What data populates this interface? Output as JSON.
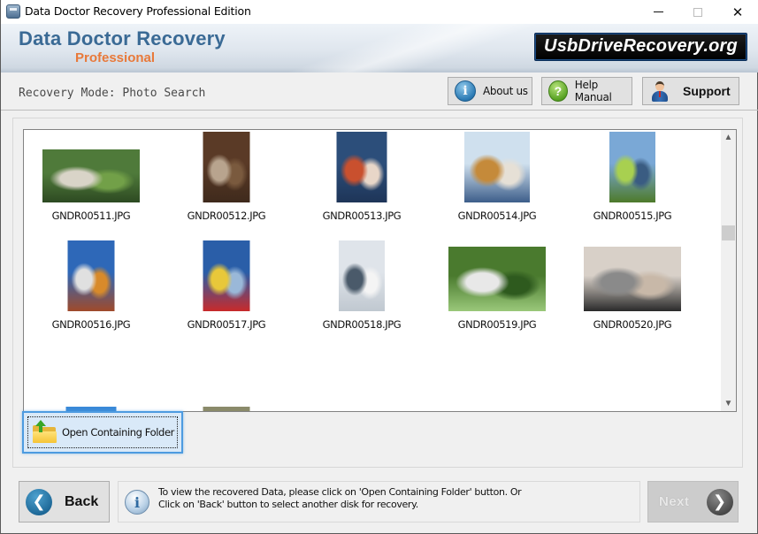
{
  "window": {
    "title": "Data Doctor Recovery Professional Edition",
    "controls": {
      "minimize": "minimize",
      "maximize": "maximize",
      "close": "✕"
    }
  },
  "header": {
    "brand_main": "Data Doctor Recovery",
    "brand_sub": "Professional",
    "site_badge": "UsbDriveRecovery.org"
  },
  "mode_bar": {
    "mode_label": "Recovery Mode: Photo Search",
    "buttons": {
      "about": {
        "label": "About us",
        "icon": "info-icon"
      },
      "help": {
        "label": "Help Manual",
        "icon": "question-icon"
      },
      "support": {
        "label": "Support",
        "icon": "person-icon"
      }
    }
  },
  "gallery": {
    "items": [
      {
        "name": "GNDR00511.JPG",
        "colors": [
          "#4f7a3a",
          "#2d4a22",
          "#d9d4c8",
          "#72a048"
        ]
      },
      {
        "name": "GNDR00512.JPG",
        "colors": [
          "#5a3a26",
          "#3f2a1c",
          "#b8a48e",
          "#7a5a3e"
        ]
      },
      {
        "name": "GNDR00513.JPG",
        "colors": [
          "#2c4e7a",
          "#1e3558",
          "#c9502e",
          "#e8d6c8"
        ]
      },
      {
        "name": "GNDR00514.JPG",
        "colors": [
          "#cfe0ee",
          "#3d5e8a",
          "#c58a3a",
          "#e6e0d6"
        ]
      },
      {
        "name": "GNDR00515.JPG",
        "colors": [
          "#7aa8d6",
          "#4e7a2a",
          "#a8d050",
          "#3a5c82"
        ]
      },
      {
        "name": "GNDR00516.JPG",
        "colors": [
          "#2e68b8",
          "#a04a2a",
          "#e0e0e0",
          "#d88a2a"
        ]
      },
      {
        "name": "GNDR00517.JPG",
        "colors": [
          "#2a5ea8",
          "#c82a2a",
          "#e8c83a",
          "#9ab8d8"
        ]
      },
      {
        "name": "GNDR00518.JPG",
        "colors": [
          "#dfe4ea",
          "#c0c8d0",
          "#4a5a6a",
          "#f4f4f4"
        ]
      },
      {
        "name": "GNDR00519.JPG",
        "colors": [
          "#4a7a2e",
          "#9ac87a",
          "#e8e8e8",
          "#2e5a1e"
        ]
      },
      {
        "name": "GNDR00520.JPG",
        "colors": [
          "#d8d0c8",
          "#2a2a2a",
          "#8a8a8a",
          "#c8b8a8"
        ]
      },
      {
        "name": "",
        "colors": [
          "#3a8ad8",
          "#e8e050",
          "#6ac8a8",
          "#d84a8a"
        ]
      },
      {
        "name": "",
        "colors": [
          "#8a8a6a",
          "#5a5a4a",
          "#e8843a",
          "#a8a890"
        ]
      },
      {
        "name": "",
        "colors": [
          "#dfe6ec",
          "#7a8a5a",
          "#3a4a3a",
          "#c8d0d8"
        ]
      },
      {
        "name": "",
        "colors": [
          "#e8e8d0",
          "#4a5a4a",
          "#c8b890",
          "#8aa868"
        ]
      },
      {
        "name": "",
        "colors": [
          "#8a7a9a",
          "#c89a7a",
          "#4a3a3a",
          "#e8b89a"
        ]
      }
    ]
  },
  "actions": {
    "open_folder": "Open Containing Folder"
  },
  "footer": {
    "back_label": "Back",
    "next_label": "Next",
    "info_line1": "To view the recovered Data, please click on 'Open Containing Folder' button. Or",
    "info_line2": "Click on 'Back' button to select another disk for recovery."
  },
  "theme": {
    "brand_blue": "#3a6a95",
    "brand_orange": "#e8793a",
    "focus_blue": "#4d9be0"
  }
}
